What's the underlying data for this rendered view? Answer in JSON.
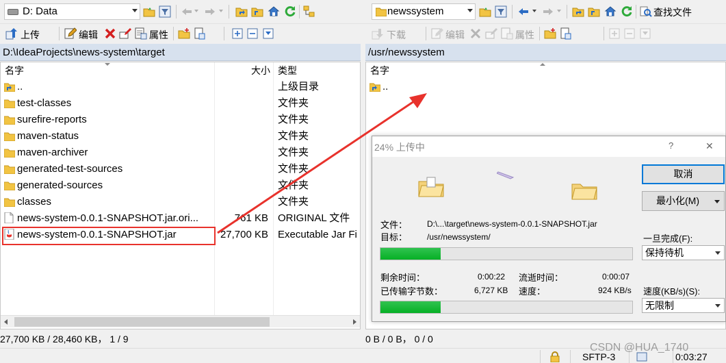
{
  "left_toolbar": {
    "drive_label": "D: Data",
    "upload_label": "上传",
    "edit_label": "编辑",
    "properties_label": "属性"
  },
  "right_toolbar": {
    "dir_label": "newssystem",
    "find_files_label": "查找文件",
    "download_label": "下载",
    "edit_label": "编辑",
    "properties_label": "属性"
  },
  "left_panel": {
    "path": "D:\\IdeaProjects\\news-system\\target",
    "columns": {
      "name": "名字",
      "size": "大小",
      "type": "类型"
    },
    "rows": [
      {
        "icon": "parent-dir-icon",
        "name": "..",
        "size": "",
        "type": "上级目录"
      },
      {
        "icon": "folder-icon",
        "name": "test-classes",
        "size": "",
        "type": "文件夹"
      },
      {
        "icon": "folder-icon",
        "name": "surefire-reports",
        "size": "",
        "type": "文件夹"
      },
      {
        "icon": "folder-icon",
        "name": "maven-status",
        "size": "",
        "type": "文件夹"
      },
      {
        "icon": "folder-icon",
        "name": "maven-archiver",
        "size": "",
        "type": "文件夹"
      },
      {
        "icon": "folder-icon",
        "name": "generated-test-sources",
        "size": "",
        "type": "文件夹"
      },
      {
        "icon": "folder-icon",
        "name": "generated-sources",
        "size": "",
        "type": "文件夹"
      },
      {
        "icon": "folder-icon",
        "name": "classes",
        "size": "",
        "type": "文件夹"
      },
      {
        "icon": "file-icon",
        "name": "news-system-0.0.1-SNAPSHOT.jar.ori...",
        "size": "761 KB",
        "type": "ORIGINAL 文件"
      },
      {
        "icon": "jar-file-icon",
        "name": "news-system-0.0.1-SNAPSHOT.jar",
        "size": "27,700 KB",
        "type": "Executable Jar Fi"
      }
    ],
    "status": "27,700 KB / 28,460 KB，  1 / 9"
  },
  "right_panel": {
    "path": "/usr/newssystem",
    "columns": {
      "name": "名字"
    },
    "rows": [
      {
        "icon": "parent-dir-icon",
        "name": ".."
      }
    ],
    "status": "0 B / 0 B，  0 / 0"
  },
  "upload_dialog": {
    "title": "24% 上传中",
    "help": "?",
    "close": "✕",
    "cancel_label": "取消",
    "minimize_label": "最小化(M)",
    "file_label": "文件：",
    "file_value": "D:\\...\\target\\news-system-0.0.1-SNAPSHOT.jar",
    "target_label": "目标：",
    "target_value": "/usr/newssystem/",
    "on_complete_label": "一旦完成(F):",
    "on_complete_value": "保持待机",
    "file_progress": 0.24,
    "remaining_label": "剩余时间：",
    "remaining_value": "0:00:22",
    "elapsed_label": "流逝时间：",
    "elapsed_value": "0:00:07",
    "transferred_label": "已传输字节数：",
    "transferred_value": "6,727 KB",
    "speed_label": "速度：",
    "speed_value": "924 KB/s",
    "speed_limit_label": "速度(KB/s)(S):",
    "speed_limit_value": "无限制",
    "total_progress": 0.24
  },
  "bottom_bar": {
    "protocol": "SFTP-3",
    "timer": "0:03:27"
  },
  "watermark": "CSDN @HUA_1740",
  "colors": {
    "path_bar": "#d7e1ee",
    "progress_green": "#06b025",
    "selection_red": "#e8322c",
    "folder_yellow": "#f2c443"
  }
}
